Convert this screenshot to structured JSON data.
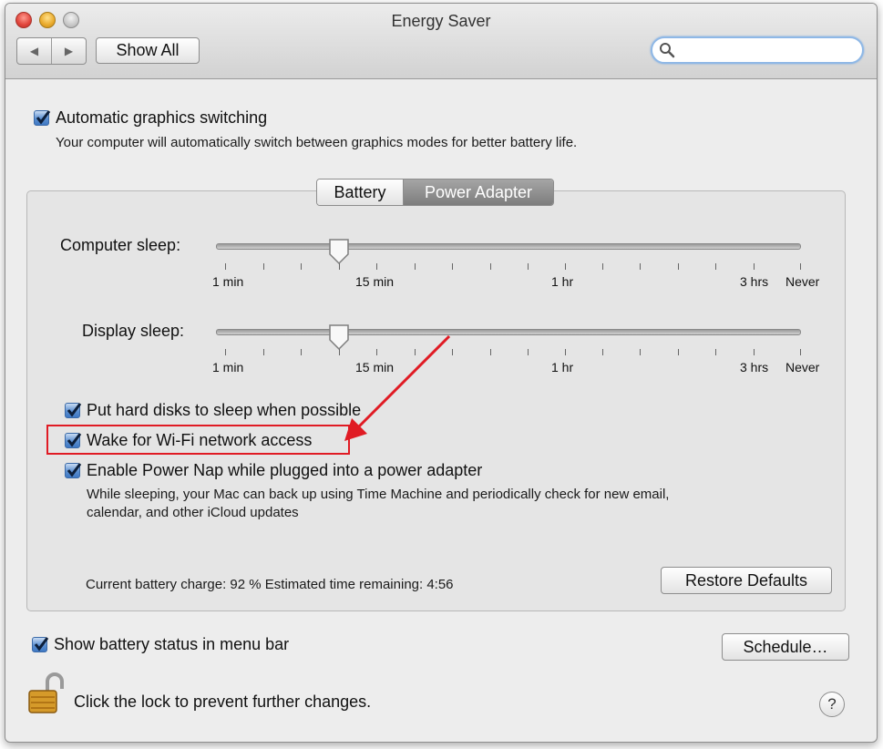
{
  "window": {
    "title": "Energy Saver"
  },
  "toolbar": {
    "back_glyph": "◀",
    "forward_glyph": "▶",
    "show_all_label": "Show All",
    "search_placeholder": "",
    "search_icon": "search-icon"
  },
  "auto_graphics": {
    "checked": true,
    "label": "Automatic graphics switching",
    "description": "Your computer will automatically switch between graphics modes for better battery life."
  },
  "tabs": [
    {
      "label": "Battery",
      "selected": false
    },
    {
      "label": "Power Adapter",
      "selected": true
    }
  ],
  "computer_sleep": {
    "label": "Computer sleep:",
    "value": "15 min",
    "ticks": [
      "1 min",
      "15 min",
      "1 hr",
      "3 hrs",
      "Never"
    ]
  },
  "display_sleep": {
    "label": "Display sleep:",
    "value": "15 min",
    "ticks": [
      "1 min",
      "15 min",
      "1 hr",
      "3 hrs",
      "Never"
    ]
  },
  "options": [
    {
      "label": "Put hard disks to sleep when possible",
      "checked": true
    },
    {
      "label": "Wake for Wi-Fi network access",
      "checked": true,
      "highlighted": true
    },
    {
      "label": "Enable Power Nap while plugged into a power adapter",
      "checked": true
    }
  ],
  "power_nap_description": [
    "While sleeping, your Mac can back up using Time Machine and periodically check for new email,",
    "calendar, and other iCloud updates"
  ],
  "status": {
    "text": "Current battery charge: 92 %  Estimated time remaining: 4:56"
  },
  "restore_defaults_label": "Restore Defaults",
  "show_battery_status": {
    "checked": true,
    "label": "Show battery status in menu bar"
  },
  "schedule_label": "Schedule…",
  "lock": {
    "label": "Click the lock to prevent further changes.",
    "icon": "padlock-open-icon"
  },
  "help_label": "?",
  "colors": {
    "highlight": "#e01b24",
    "accent": "#3f78c3",
    "selected_tab": "#8e8e8e"
  }
}
